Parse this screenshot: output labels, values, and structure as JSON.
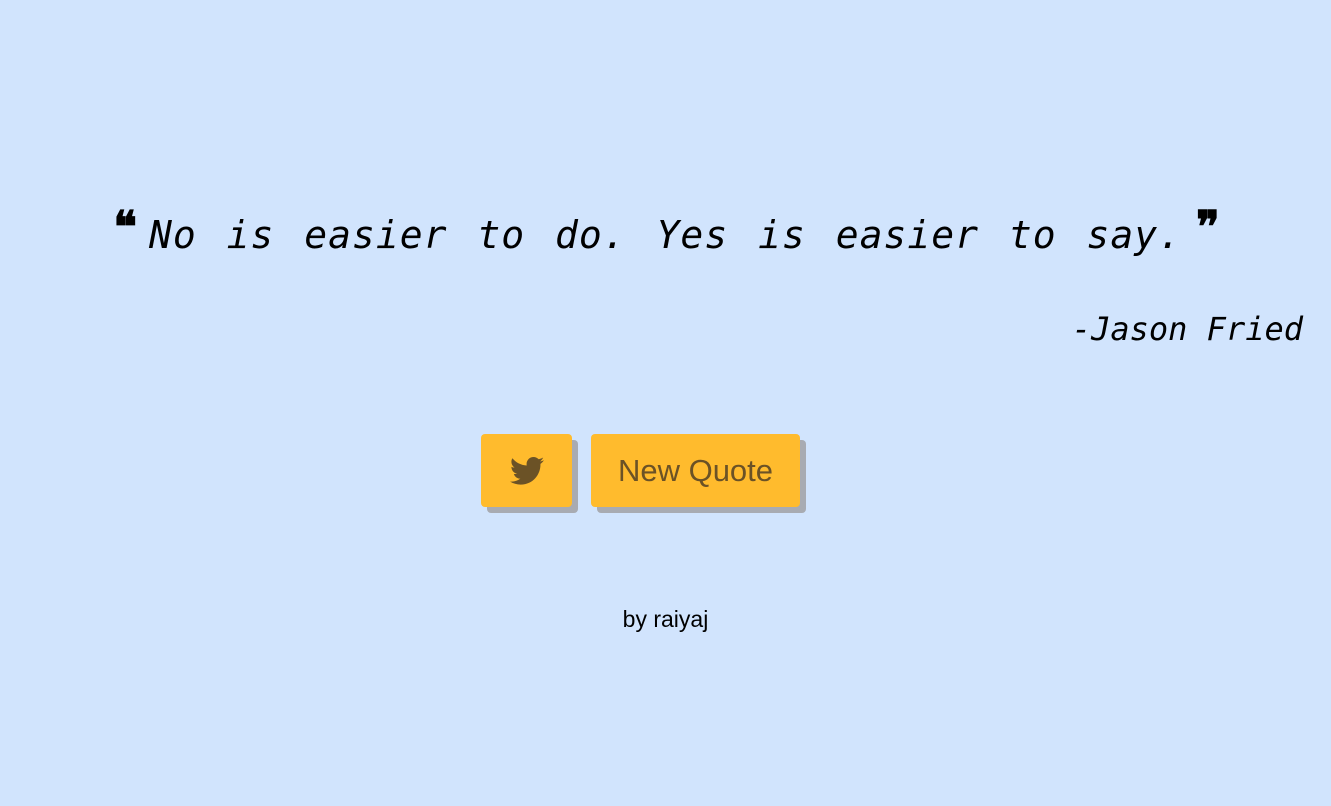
{
  "quote": {
    "open_mark": "❝",
    "text": "No is easier to do. Yes is easier to say.",
    "close_mark": "❞"
  },
  "author": "-Jason Fried",
  "buttons": {
    "twitter_icon": "twitter-icon",
    "new_quote_label": "New Quote"
  },
  "credit": "by raiyaj",
  "colors": {
    "background": "#d1e4fd",
    "button": "#ffbb2d",
    "button_text": "#6b5226",
    "button_shadow": "#a8abb2"
  }
}
